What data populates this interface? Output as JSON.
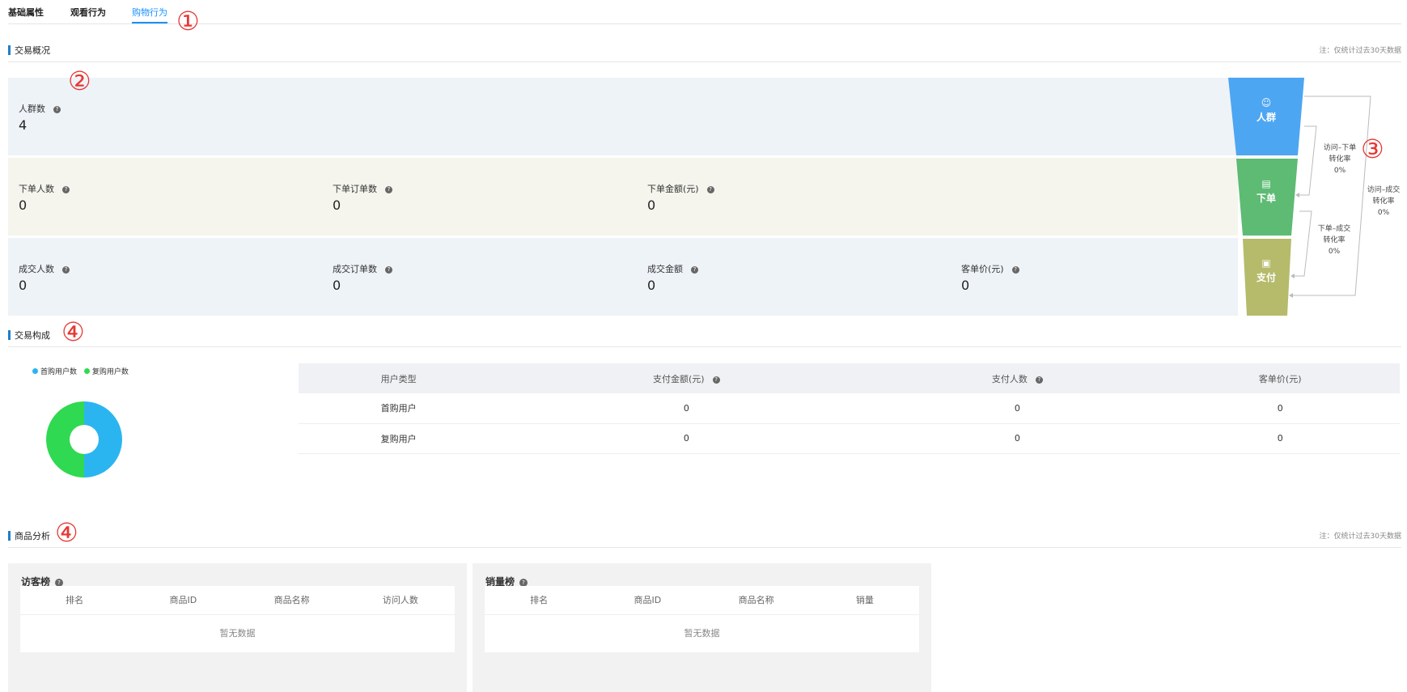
{
  "tabs": [
    "基础属性",
    "观看行为",
    "购物行为"
  ],
  "annotations": [
    "①",
    "②",
    "③",
    "④",
    "④"
  ],
  "sections": {
    "overview": {
      "title": "交易概况",
      "note": "注：仅统计过去30天数据"
    },
    "composition": {
      "title": "交易构成"
    },
    "product": {
      "title": "商品分析",
      "note": "注：仅统计过去30天数据"
    }
  },
  "help_icon": "?",
  "metrics": {
    "crowd": {
      "label": "人群数",
      "value": "4"
    },
    "order_users": {
      "label": "下单人数",
      "value": "0"
    },
    "order_count": {
      "label": "下单订单数",
      "value": "0"
    },
    "order_amount": {
      "label": "下单金额(元)",
      "value": "0"
    },
    "deal_users": {
      "label": "成交人数",
      "value": "0"
    },
    "deal_orders": {
      "label": "成交订单数",
      "value": "0"
    },
    "deal_amount": {
      "label": "成交金额",
      "value": "0"
    },
    "avg_price": {
      "label": "客单价(元)",
      "value": "0"
    }
  },
  "funnel": {
    "stages": [
      {
        "label": "人群",
        "icon": "person-icon",
        "color": "#4da6f2"
      },
      {
        "label": "下单",
        "icon": "document-icon",
        "color": "#5dbb73"
      },
      {
        "label": "支付",
        "icon": "bag-icon",
        "color": "#b5bb6a"
      }
    ],
    "rates": [
      {
        "line1": "访问–下单",
        "line2": "转化率",
        "value": "0%"
      },
      {
        "line1": "下单–成交",
        "line2": "转化率",
        "value": "0%"
      },
      {
        "line1": "访问–成交",
        "line2": "转化率",
        "value": "0%"
      }
    ]
  },
  "composition": {
    "legend": [
      {
        "label": "首购用户数",
        "color": "#2bb5f0"
      },
      {
        "label": "复购用户数",
        "color": "#2fd951"
      }
    ],
    "table": {
      "headers": [
        "用户类型",
        "支付金额(元)",
        "支付人数",
        "客单价(元)"
      ],
      "rows": [
        [
          "首购用户",
          "0",
          "0",
          "0"
        ],
        [
          "复购用户",
          "0",
          "0",
          "0"
        ]
      ]
    }
  },
  "chart_data": {
    "type": "pie",
    "categories": [
      "首购用户数",
      "复购用户数"
    ],
    "values": [
      50,
      50
    ],
    "colors": [
      "#2bb5f0",
      "#2fd951"
    ],
    "donut": true,
    "legend": "top-left"
  },
  "product": {
    "visitors": {
      "title": "访客榜",
      "columns": [
        "排名",
        "商品ID",
        "商品名称",
        "访问人数"
      ],
      "empty": "暂无数据"
    },
    "sales": {
      "title": "销量榜",
      "columns": [
        "排名",
        "商品ID",
        "商品名称",
        "销量"
      ],
      "empty": "暂无数据"
    }
  }
}
